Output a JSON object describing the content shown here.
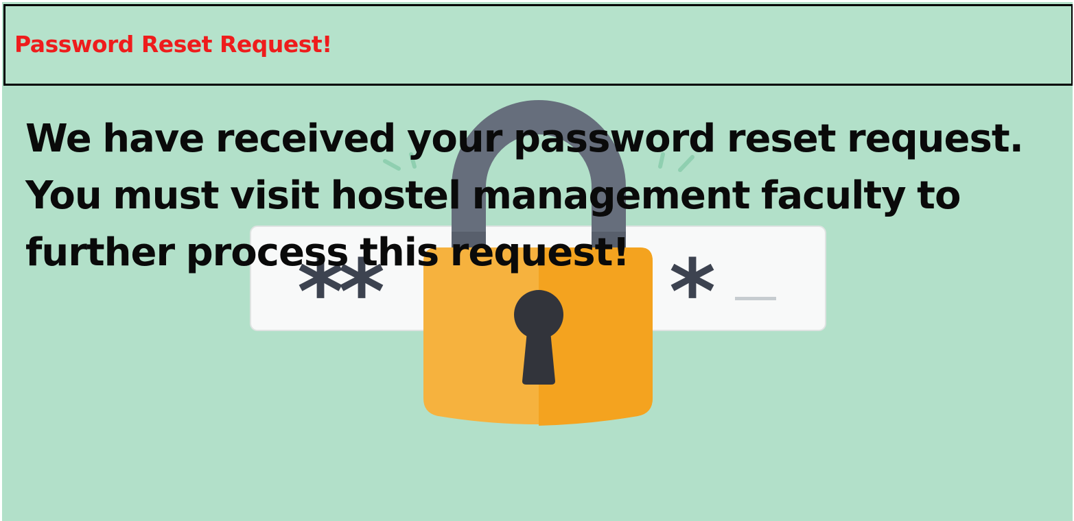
{
  "header": {
    "title": "Password Reset Request!"
  },
  "message": {
    "text": "We have received your password reset request. You must visit hostel management faculty to further process this request!"
  },
  "illustration": {
    "icon": "padlock-icon",
    "password_field": {
      "masked_left": "**",
      "masked_right": "*"
    }
  },
  "colors": {
    "background": "#b2e0c9",
    "title": "#ee1c1c",
    "lock_body_left": "#f6b23e",
    "lock_body_right": "#f4a31f",
    "shackle": "#666e7c",
    "keyhole": "#32343b",
    "field": "#f8f9f9"
  }
}
